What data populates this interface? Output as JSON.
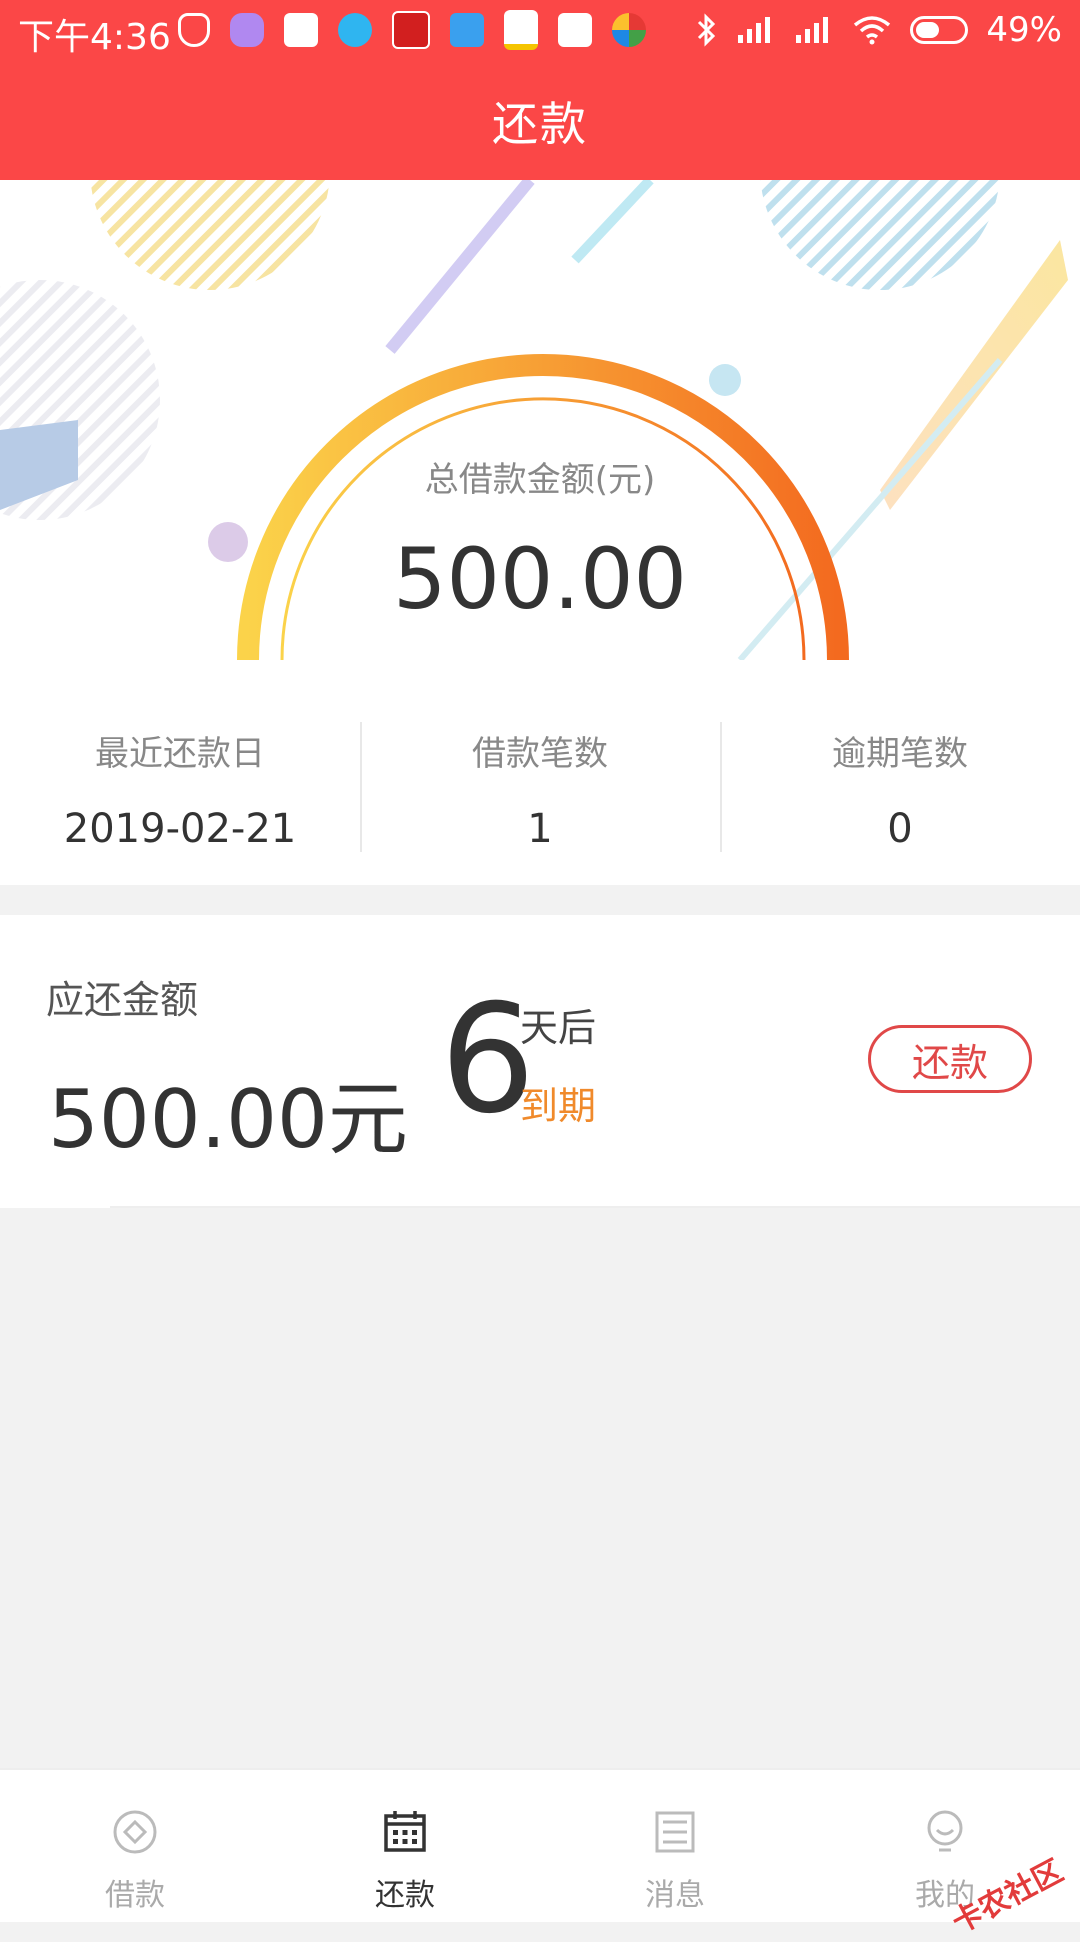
{
  "status_bar": {
    "time": "下午4:36",
    "battery": "49%",
    "battery_level": 0.49
  },
  "header": {
    "title": "还款"
  },
  "summary": {
    "label": "总借款金额(元)",
    "amount": "500.00"
  },
  "stats": [
    {
      "label": "最近还款日",
      "value": "2019-02-21"
    },
    {
      "label": "借款笔数",
      "value": "1"
    },
    {
      "label": "逾期笔数",
      "value": "0"
    }
  ],
  "due": {
    "title": "应还金额",
    "amount": "500.00元",
    "days": "6",
    "after_label": "天后",
    "expire_label": "到期",
    "pay_button": "还款"
  },
  "bottom_nav": [
    {
      "label": "借款",
      "icon": "loan-icon",
      "active": false
    },
    {
      "label": "还款",
      "icon": "calendar-icon",
      "active": true
    },
    {
      "label": "消息",
      "icon": "message-icon",
      "active": false
    },
    {
      "label": "我的",
      "icon": "profile-icon",
      "active": false
    }
  ],
  "watermark": "卡农社区",
  "colors": {
    "brand_red": "#fb4747",
    "button_red": "#e04848",
    "due_orange": "#f08a2b",
    "ring_start": "#fbd34a",
    "ring_end": "#f36a1f"
  }
}
